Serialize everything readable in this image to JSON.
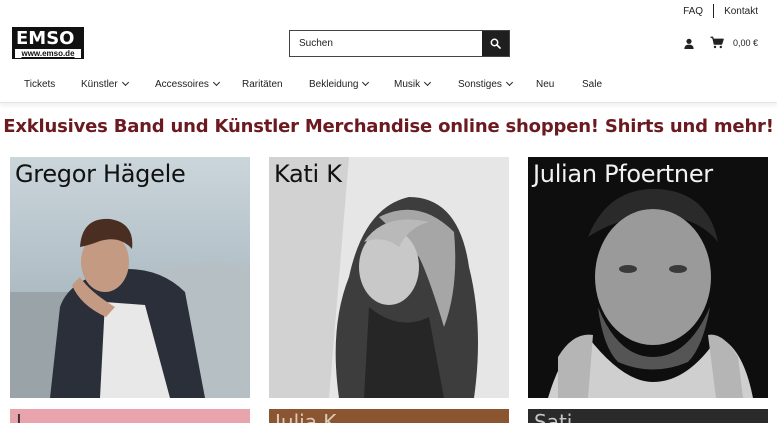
{
  "top_links": {
    "faq": "FAQ",
    "contact": "Kontakt"
  },
  "logo": {
    "main": "EMSO",
    "sub": "www.emso.de"
  },
  "search": {
    "placeholder": "Suchen"
  },
  "cart": {
    "total": "0,00 €"
  },
  "nav": [
    {
      "label": "Tickets",
      "dropdown": false
    },
    {
      "label": "Künstler",
      "dropdown": true
    },
    {
      "label": "Accessoires",
      "dropdown": true
    },
    {
      "label": "Raritäten",
      "dropdown": false
    },
    {
      "label": "Bekleidung",
      "dropdown": true
    },
    {
      "label": "Musik",
      "dropdown": true
    },
    {
      "label": "Sonstiges",
      "dropdown": true
    },
    {
      "label": "Neu",
      "dropdown": false
    },
    {
      "label": "Sale",
      "dropdown": false
    }
  ],
  "headline": "Exklusives Band und Künstler Merchandise online shoppen! Shirts und mehr!",
  "artists": [
    {
      "name": "Gregor Hägele"
    },
    {
      "name": "Kati K"
    },
    {
      "name": "Julian Pfoertner"
    }
  ],
  "artists_row2": [
    {
      "name": "I"
    },
    {
      "name": "Julia K"
    },
    {
      "name": "Sati"
    }
  ],
  "colors": {
    "headline": "#6b1a1f",
    "dark": "#1f1f1f"
  },
  "icons": [
    "search-icon",
    "user-icon",
    "cart-icon",
    "chevron-down-icon"
  ]
}
